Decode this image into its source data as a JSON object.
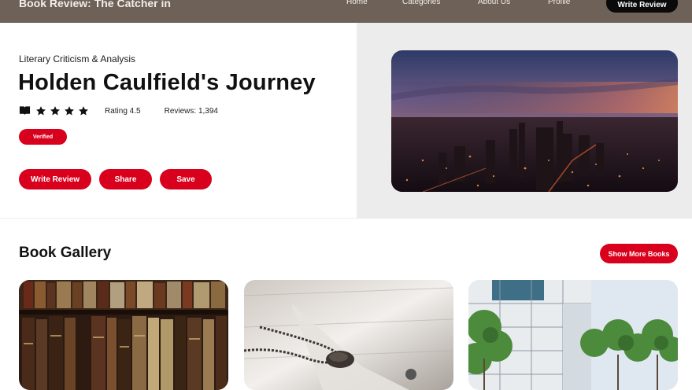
{
  "nav": {
    "brand": "Book Review: The Catcher in",
    "links": [
      "Home",
      "Categories",
      "About Us",
      "Profile"
    ],
    "cta": "Write Review"
  },
  "hero": {
    "eyebrow": "Literary Criticism & Analysis",
    "title": "Holden Caulfield's Journey",
    "rating_label": "Rating 4.5",
    "reviews_label": "Reviews: 1,394",
    "stars": 5,
    "badge": "Verified",
    "buttons": [
      "Write Review",
      "Share",
      "Save"
    ],
    "image_alt": "city-skyline-at-dusk-image"
  },
  "gallery": {
    "title": "Book Gallery",
    "show_more": "Show More Books",
    "cards": [
      "old-books-shelf-image",
      "necklace-on-wood-image",
      "building-and-trees-image"
    ]
  },
  "colors": {
    "nav_bg": "#6e6158",
    "accent": "#d8001c",
    "cta_bg": "#0a0a0a",
    "hero_panel": "#ececec"
  }
}
